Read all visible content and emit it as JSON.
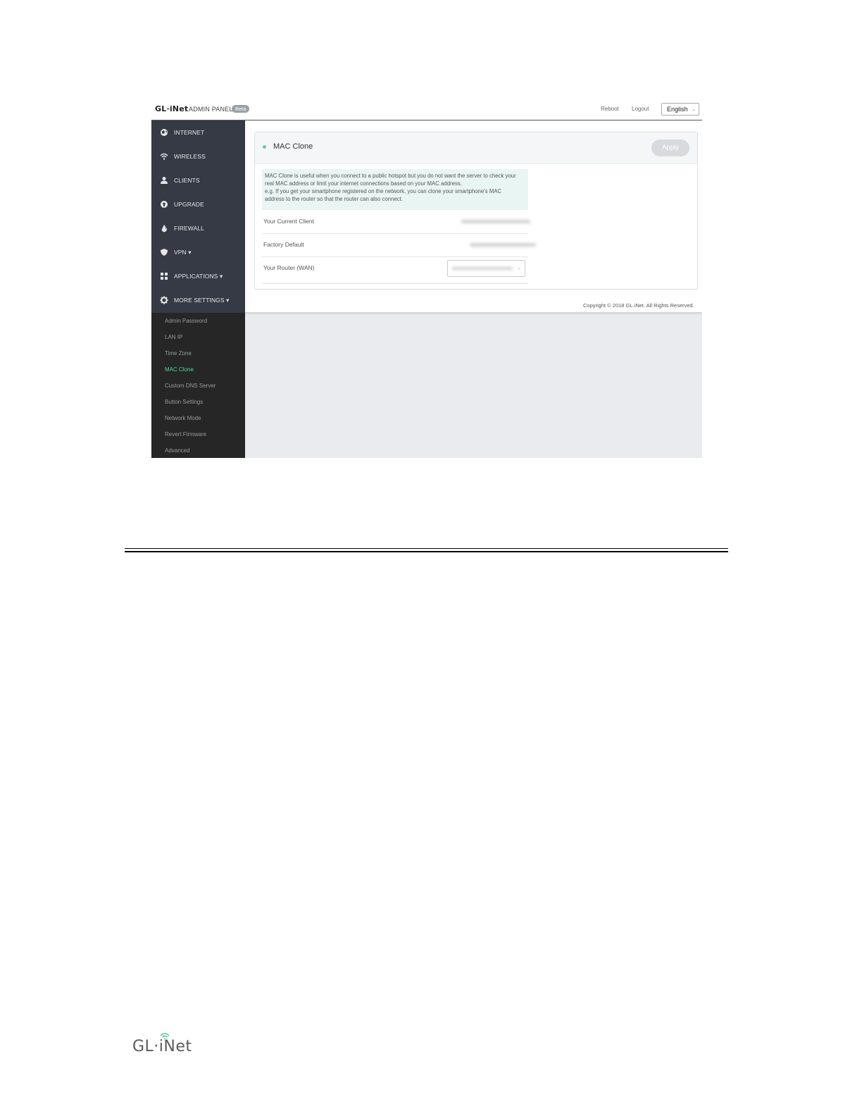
{
  "header": {
    "logo": "GL·iNet",
    "admin_panel": "ADMIN PANEL",
    "beta_badge": "Beta",
    "reboot": "Reboot",
    "logout": "Logout",
    "language": "English"
  },
  "sidebar": {
    "items": [
      {
        "label": "INTERNET",
        "icon": "globe-icon"
      },
      {
        "label": "WIRELESS",
        "icon": "wifi-icon"
      },
      {
        "label": "CLIENTS",
        "icon": "user-icon"
      },
      {
        "label": "UPGRADE",
        "icon": "upgrade-icon"
      },
      {
        "label": "FIREWALL",
        "icon": "fire-icon"
      },
      {
        "label": "VPN ▾",
        "icon": "shield-icon"
      },
      {
        "label": "APPLICATIONS ▾",
        "icon": "grid-icon"
      },
      {
        "label": "MORE SETTINGS ▾",
        "icon": "gear-icon"
      }
    ],
    "subitems": [
      "Admin Password",
      "LAN IP",
      "Time Zone",
      "MAC Clone",
      "Custom DNS Server",
      "Button Settings",
      "Network Mode",
      "Revert Firmware",
      "Advanced"
    ],
    "active_subitem": "MAC Clone"
  },
  "panel": {
    "title": "MAC Clone",
    "apply_label": "Apply",
    "info_line1": "MAC Clone is useful when you connect to a public hotspot but you do not want the server to check your",
    "info_line2": "real MAC address or limit your internet connections based on your MAC address.",
    "info_line3": "e.g. If you get your smartphone registered on the network, you can clone your smartphone's MAC",
    "info_line4": "address to the router so that the router can also connect.",
    "rows": [
      {
        "label": "Your Current Client"
      },
      {
        "label": "Factory Default"
      },
      {
        "label": "Your Router (WAN)"
      }
    ]
  },
  "copyright": "Copyright © 2018 GL.iNet. All Rights Reserved.",
  "footer_logo": "GL·iNet",
  "colors": {
    "sidebar_bg": "#353a45",
    "subnav_bg": "#262626",
    "accent_green": "#57d39b",
    "main_bg": "#e9ebee",
    "info_bg": "#e9f5f3"
  }
}
